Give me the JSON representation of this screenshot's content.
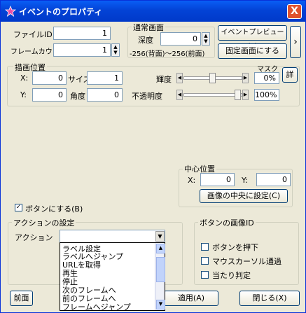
{
  "title": "イベントのプロパティ",
  "close_symbol": "X",
  "file_id": {
    "label": "ファイルID",
    "value": "1"
  },
  "frame_count": {
    "label": "フレームカウント",
    "value": "1"
  },
  "layer": {
    "group_label": "通常画面",
    "depth_label": "深度",
    "depth_value": "0",
    "range_text": "-256(背面)～256(前面)"
  },
  "buttons": {
    "preview": "イベントプレビュー(P)",
    "fixed": "固定画面にする",
    "more_symbol": "›",
    "detail": "詳",
    "center_image": "画像の中央に設定(C)",
    "front": "前面",
    "apply": "適用(A)",
    "close": "閉じる(X)"
  },
  "draw_position": {
    "group_label": "描画位置",
    "x_label": "X:",
    "x_value": "0",
    "y_label": "Y:",
    "y_value": "0",
    "size_label": "サイズ",
    "size_value": "1",
    "angle_label": "角度",
    "angle_value": "0",
    "brightness_label": "輝度",
    "brightness_value": "0%",
    "brightness_level": 0.0,
    "opacity_label": "不透明度",
    "opacity_value": "100%",
    "opacity_level": 1.0,
    "mask_label": "マスク"
  },
  "center": {
    "group_label": "中心位置",
    "x_label": "X:",
    "x_value": "0",
    "y_label": "Y:",
    "y_value": "0"
  },
  "make_button": {
    "label": "ボタンにする(B)",
    "checked": true
  },
  "action_settings": {
    "group_label": "アクションの設定",
    "action_label": "アクション",
    "options": [
      "ラベル設定",
      "ラベルへジャンプ",
      "URLを取得",
      "再生",
      "停止",
      "次のフレームへ",
      "前のフレームへ",
      "フレームへジャンプ"
    ]
  },
  "button_image": {
    "group_label": "ボタンの画像ID",
    "options": [
      {
        "label": "ボタンを押下",
        "checked": false
      },
      {
        "label": "マウスカーソル通過",
        "checked": false
      },
      {
        "label": "当たり判定",
        "checked": false
      }
    ]
  },
  "colors": {
    "titlebar": "#0343d6",
    "window": "#ece9d8",
    "selection_border": "#000000"
  }
}
